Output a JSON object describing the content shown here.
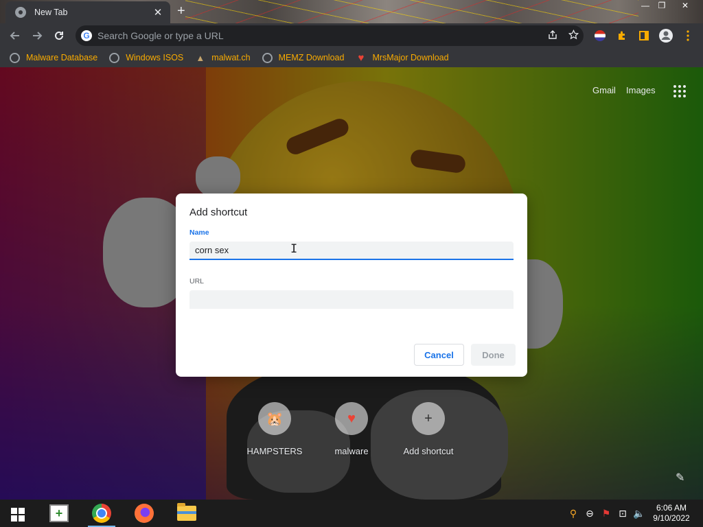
{
  "browser": {
    "tab": {
      "title": "New Tab",
      "close_glyph": "✕"
    },
    "new_tab_glyph": "+",
    "window_controls": {
      "minimize": "—",
      "maximize": "❐",
      "close": "✕"
    },
    "omnibox": {
      "placeholder": "Search Google or type a URL",
      "g_letter": "G"
    },
    "bookmarks": [
      {
        "label": "Malware Database",
        "icon": "globe-icon"
      },
      {
        "label": "Windows ISOS",
        "icon": "globe-icon"
      },
      {
        "label": "malwat.ch",
        "icon": "bear-icon"
      },
      {
        "label": "MEMZ Download",
        "icon": "globe-icon"
      },
      {
        "label": "MrsMajor Download",
        "icon": "heart-icon"
      }
    ]
  },
  "newtab": {
    "gmail": "Gmail",
    "images": "Images",
    "shortcuts": [
      {
        "label": "HAMPSTERS",
        "icon": "hamster-icon",
        "glyph": "🐹"
      },
      {
        "label": "malware",
        "icon": "heart-icon",
        "glyph": "♥"
      },
      {
        "label": "Add shortcut",
        "icon": "plus-icon",
        "glyph": "+"
      }
    ]
  },
  "dialog": {
    "title": "Add shortcut",
    "name_label": "Name",
    "name_value": "corn sex",
    "url_label": "URL",
    "url_value": "",
    "cancel": "Cancel",
    "done": "Done"
  },
  "taskbar": {
    "time": "6:06 AM",
    "date": "9/10/2022"
  }
}
